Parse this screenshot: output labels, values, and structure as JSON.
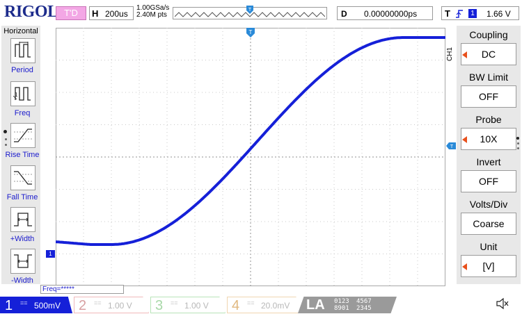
{
  "brand": "RIGOL",
  "trigger_status": "T'D",
  "horizontal": {
    "key": "H",
    "timebase": "200us",
    "sample_rate": "1.00GSa/s",
    "memory_depth": "2.40M pts"
  },
  "delay": {
    "key": "D",
    "value": "0.00000000ps"
  },
  "trigger": {
    "key": "T",
    "source": "1",
    "level": "1.66 V",
    "edge_icon": "rising-edge-icon"
  },
  "left_panel": {
    "title": "Horizontal",
    "items": [
      {
        "label": "Period",
        "icon": "period-icon"
      },
      {
        "label": "Freq",
        "icon": "freq-icon"
      },
      {
        "label": "Rise Time",
        "icon": "rise-time-icon"
      },
      {
        "label": "Fall Time",
        "icon": "fall-time-icon"
      },
      {
        "label": "+Width",
        "icon": "pos-width-icon"
      },
      {
        "label": "-Width",
        "icon": "neg-width-icon"
      }
    ]
  },
  "channel_menu": {
    "channel": "CH1",
    "items": [
      {
        "title": "Coupling",
        "value": "DC"
      },
      {
        "title": "BW Limit",
        "value": "OFF"
      },
      {
        "title": "Probe",
        "value": "10X"
      },
      {
        "title": "Invert",
        "value": "OFF"
      },
      {
        "title": "Volts/Div",
        "value": "Coarse"
      },
      {
        "title": "Unit",
        "value": "[V]"
      }
    ]
  },
  "measurement": {
    "freq_readout": "Freq=*****"
  },
  "markers": {
    "ch1": "1",
    "trigger_level": "T",
    "trigger_position": "T"
  },
  "channels": [
    {
      "num": "1",
      "coupling": "==",
      "scale": "500mV"
    },
    {
      "num": "2",
      "coupling": "==",
      "scale": "1.00 V"
    },
    {
      "num": "3",
      "coupling": "==",
      "scale": "1.00 V"
    },
    {
      "num": "4",
      "coupling": "==",
      "scale": "20.0mV"
    }
  ],
  "la": {
    "label": "LA",
    "groups": [
      "0123",
      "8901",
      "4567",
      "2345"
    ]
  },
  "colors": {
    "ch1": "#1520d8",
    "brand": "#1d2c8c",
    "trigger_status": "#f3a7e5",
    "panel": "#e8e8e8",
    "arrow": "#e8501c"
  }
}
